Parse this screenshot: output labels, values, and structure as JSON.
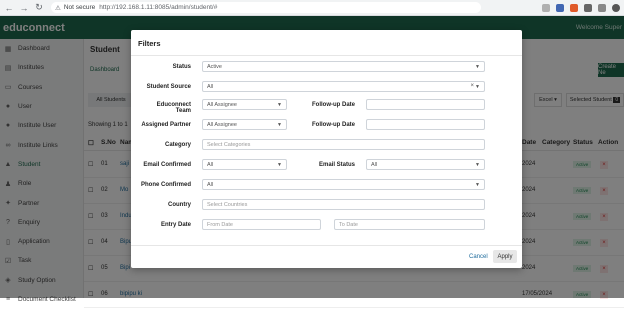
{
  "browser": {
    "security_label": "Not secure",
    "url": "http://192.168.1.11:8085/admin/student/#"
  },
  "app": {
    "logo": "educonnect",
    "welcome": "Welcome Super"
  },
  "sidebar": {
    "items": [
      {
        "label": "Dashboard",
        "icon": "dashboard-icon"
      },
      {
        "label": "Institutes",
        "icon": "building-icon"
      },
      {
        "label": "Courses",
        "icon": "book-icon"
      },
      {
        "label": "User",
        "icon": "user-icon"
      },
      {
        "label": "Institute User",
        "icon": "user-icon"
      },
      {
        "label": "Institute Links",
        "icon": "link-icon"
      },
      {
        "label": "Student",
        "icon": "graduation-cap-icon"
      },
      {
        "label": "Role",
        "icon": "users-icon"
      },
      {
        "label": "Partner",
        "icon": "handshake-icon"
      },
      {
        "label": "Enquiry",
        "icon": "question-icon"
      },
      {
        "label": "Application",
        "icon": "document-icon"
      },
      {
        "label": "Task",
        "icon": "task-icon"
      },
      {
        "label": "Study Option",
        "icon": "study-icon"
      },
      {
        "label": "Document Checklist",
        "icon": "checklist-icon"
      }
    ]
  },
  "page": {
    "title": "Student",
    "breadcrumb": "Dashboard",
    "create_label": "Create Ne",
    "tab_all": "All Students",
    "excel_label": "Excel ▾",
    "selected_label": "Selected Student",
    "selected_count": "0",
    "showing": "Showing 1 to 1"
  },
  "table": {
    "headers": {
      "sno": "S.No",
      "name": "Nam",
      "date": "Date",
      "category": "Category",
      "status": "Status",
      "action": "Action"
    },
    "rows": [
      {
        "sno": "01",
        "name": "saji",
        "date": "2024",
        "status": "Active"
      },
      {
        "sno": "02",
        "name": "Mo",
        "date": "2024",
        "status": "Active"
      },
      {
        "sno": "03",
        "name": "Indu",
        "date": "2024",
        "status": "Active"
      },
      {
        "sno": "04",
        "name": "Bipu",
        "date": "2024",
        "status": "Active"
      },
      {
        "sno": "05",
        "name": "Bipi",
        "date": "2024",
        "status": "Active"
      },
      {
        "sno": "06",
        "name": "bipipu ki",
        "date": "17/05/2024",
        "status": "Active"
      }
    ]
  },
  "filters": {
    "title": "Filters",
    "status": {
      "label": "Status",
      "value": "Active"
    },
    "student_source": {
      "label": "Student Source",
      "value": "All"
    },
    "educonnect_team": {
      "label": "Educonnect Team",
      "value": "All Assignee"
    },
    "followup_date_1": {
      "label": "Follow-up Date",
      "value": ""
    },
    "assigned_partner": {
      "label": "Assigned Partner",
      "value": "All Assignee"
    },
    "followup_date_2": {
      "label": "Follow-up Date",
      "value": ""
    },
    "category": {
      "label": "Category",
      "placeholder": "Select Categories"
    },
    "email_confirmed": {
      "label": "Email Confirmed",
      "value": "All"
    },
    "email_status": {
      "label": "Email Status",
      "value": "All"
    },
    "phone_confirmed": {
      "label": "Phone Confirmed",
      "value": "All"
    },
    "country": {
      "label": "Country",
      "placeholder": "Select Countries"
    },
    "entry_date": {
      "label": "Entry Date",
      "from_placeholder": "From Date",
      "to_placeholder": "To Date"
    },
    "cancel_label": "Cancel",
    "apply_label": "Apply"
  },
  "colors": {
    "brand": "#1e6b4e",
    "overlay": "rgba(0,0,0,0.5)"
  }
}
